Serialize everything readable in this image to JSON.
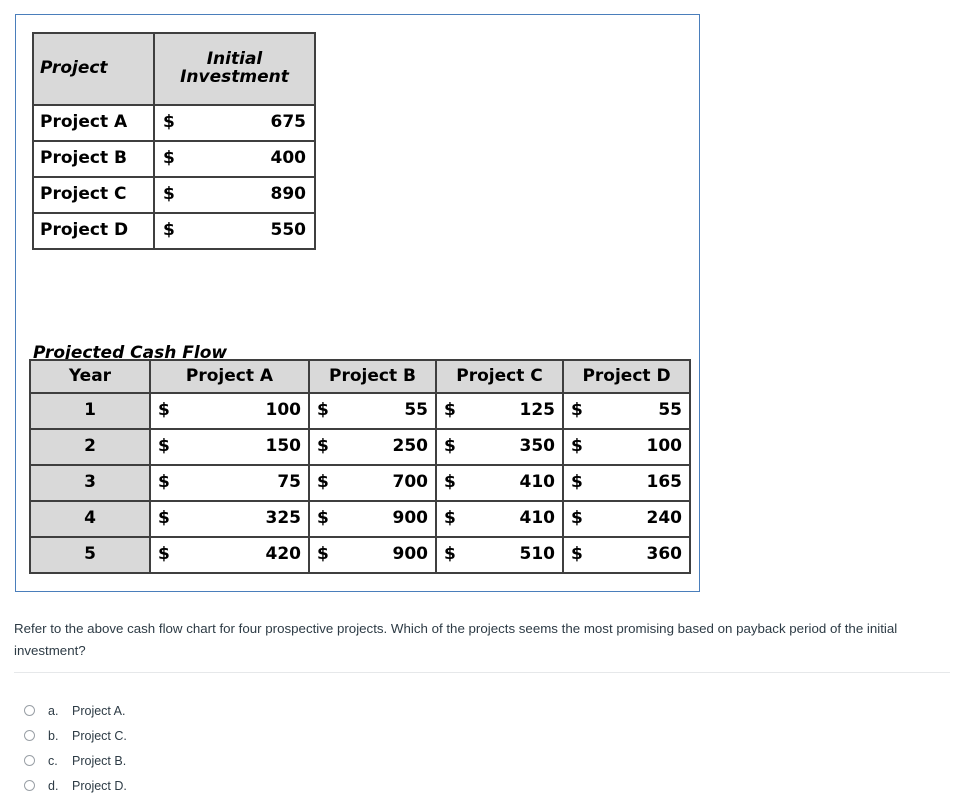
{
  "image_block": {
    "border_color": "#4a7ebb",
    "investment_table": {
      "headers": [
        "Project",
        "Initial Investment"
      ],
      "header_project": "Project",
      "header_initial": "Initial",
      "header_investment": "Investment",
      "rows": [
        {
          "name": "Project A",
          "symbol": "$",
          "amount": "675"
        },
        {
          "name": "Project B",
          "symbol": "$",
          "amount": "400"
        },
        {
          "name": "Project C",
          "symbol": "$",
          "amount": "890"
        },
        {
          "name": "Project D",
          "symbol": "$",
          "amount": "550"
        }
      ]
    },
    "cashflow_title": "Projected Cash Flow",
    "cashflow_table": {
      "headers": [
        "Year",
        "Project A",
        "Project B",
        "Project C",
        "Project D"
      ],
      "currency_symbol": "$",
      "rows": [
        {
          "year": "1",
          "a": "100",
          "b": "55",
          "c": "125",
          "d": "55"
        },
        {
          "year": "2",
          "a": "150",
          "b": "250",
          "c": "350",
          "d": "100"
        },
        {
          "year": "3",
          "a": "75",
          "b": "700",
          "c": "410",
          "d": "165"
        },
        {
          "year": "4",
          "a": "325",
          "b": "900",
          "c": "410",
          "d": "240"
        },
        {
          "year": "5",
          "a": "420",
          "b": "900",
          "c": "510",
          "d": "360"
        }
      ]
    }
  },
  "question": {
    "text": "Refer to the above cash flow chart for four prospective projects. Which of the projects seems the most promising based on payback period of the initial investment?"
  },
  "answers": [
    {
      "letter": "a.",
      "text": "Project A."
    },
    {
      "letter": "b.",
      "text": "Project C."
    },
    {
      "letter": "c.",
      "text": "Project B."
    },
    {
      "letter": "d.",
      "text": "Project D."
    }
  ],
  "chart_data": {
    "type": "table",
    "title": "Projected Cash Flow",
    "tables": [
      {
        "name": "Initial Investment",
        "columns": [
          "Project",
          "Initial Investment"
        ],
        "rows": [
          [
            "Project A",
            675
          ],
          [
            "Project B",
            400
          ],
          [
            "Project C",
            890
          ],
          [
            "Project D",
            550
          ]
        ]
      },
      {
        "name": "Projected Cash Flow",
        "columns": [
          "Year",
          "Project A",
          "Project B",
          "Project C",
          "Project D"
        ],
        "rows": [
          [
            1,
            100,
            55,
            125,
            55
          ],
          [
            2,
            150,
            250,
            350,
            100
          ],
          [
            3,
            75,
            700,
            410,
            165
          ],
          [
            4,
            325,
            900,
            410,
            240
          ],
          [
            5,
            420,
            900,
            510,
            360
          ]
        ]
      }
    ]
  }
}
